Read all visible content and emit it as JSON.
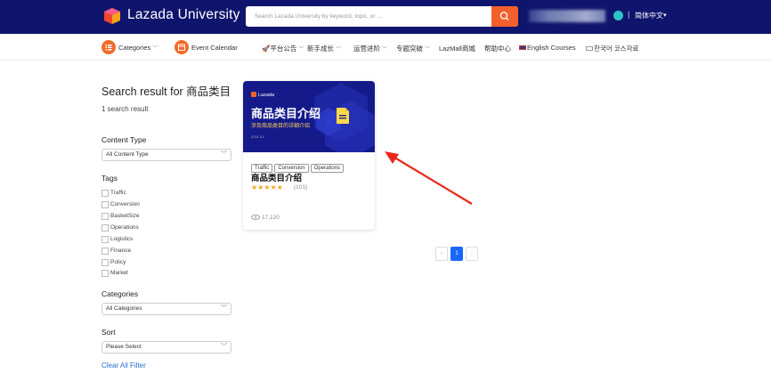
{
  "header": {
    "logo_brand": "Lazada",
    "logo_suffix": "University",
    "search_placeholder": "Search Lazada University by keyword, topic, or ...",
    "language": "简体中文"
  },
  "nav": {
    "items": [
      {
        "label": "Categories"
      },
      {
        "label": "Event Calendar"
      },
      {
        "label": "🚀平台公告"
      },
      {
        "label": "新手成长"
      },
      {
        "label": "运营进阶"
      },
      {
        "label": "专题突破"
      },
      {
        "label": "LazMall商城"
      },
      {
        "label": "帮助中心"
      },
      {
        "label": "English Courses"
      },
      {
        "label": "한국어 코스자료"
      }
    ]
  },
  "results": {
    "title": "Search result for 商品类目",
    "count": "1 search result"
  },
  "filters": {
    "content_type_label": "Content Type",
    "content_type_value": "All Content Type",
    "tags_label": "Tags",
    "tags": [
      "Traffic",
      "Conversion",
      "BasketSize",
      "Operations",
      "Logistics",
      "Finance",
      "Policy",
      "Market"
    ],
    "categories_label": "Categories",
    "categories_value": "All Categories",
    "sort_label": "Sort",
    "sort_value": "Please Select",
    "clear_label": "Clear All Filter"
  },
  "card": {
    "thumb_brand": "Lazada",
    "thumb_title": "商品类目介绍",
    "thumb_subtitle": "涉及商品类目的详细介绍",
    "thumb_date": "2021.01",
    "chips": [
      "Traffic",
      "Conversion",
      "Operations"
    ],
    "title": "商品类目介绍",
    "stars": "★★★★★",
    "rating_count": "(101)",
    "views": "17,120"
  },
  "pagination": {
    "prev": "‹",
    "page": "1",
    "next": "›"
  },
  "colors": {
    "header_bg": "#0f146d",
    "accent": "#f3602b",
    "active_page": "#1967ff",
    "arrow": "#e8281c"
  }
}
